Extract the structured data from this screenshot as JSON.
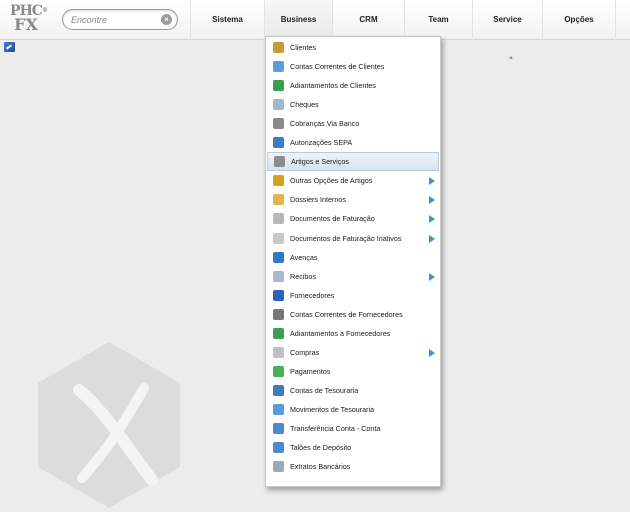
{
  "logo": {
    "line1": "PHC",
    "line2": "FX",
    "mark": "®"
  },
  "search": {
    "placeholder": "Encontre",
    "value": "",
    "clear_symbol": "×"
  },
  "nav": [
    {
      "label": "Sistema"
    },
    {
      "label": "Business"
    },
    {
      "label": "CRM"
    },
    {
      "label": "Team"
    },
    {
      "label": "Service"
    },
    {
      "label": "Opções"
    }
  ],
  "menu": {
    "items": [
      {
        "label": "Clientes",
        "icon": "user-icon",
        "color": "#c99a3a",
        "submenu": false
      },
      {
        "label": "Contas Correntes de Clientes",
        "icon": "folder-icon",
        "color": "#5aa0d8",
        "submenu": false
      },
      {
        "label": "Adiantamentos de Clientes",
        "icon": "money-green-icon",
        "color": "#3aa050",
        "submenu": false
      },
      {
        "label": "Cheques",
        "icon": "cheque-icon",
        "color": "#9bbad4",
        "submenu": false
      },
      {
        "label": "Cobranças Via Banco",
        "icon": "bank-building-icon",
        "color": "#8a8a8a",
        "submenu": false
      },
      {
        "label": "Autorizações SEPA",
        "icon": "sepa-icon",
        "color": "#3b7fc4",
        "submenu": false
      },
      {
        "label": "Artigos e Serviços",
        "icon": "articles-box-icon",
        "color": "#8c8c8c",
        "submenu": false,
        "active": true
      },
      {
        "label": "Outras Opções de Artigos",
        "icon": "bottle-icon",
        "color": "#d9a11f",
        "submenu": true
      },
      {
        "label": "Dossiers Internos",
        "icon": "dossier-icon",
        "color": "#e0b64a",
        "submenu": true
      },
      {
        "label": "Documentos de Faturação",
        "icon": "invoice-doc-icon",
        "color": "#b8b8b8",
        "submenu": true
      },
      {
        "label": "Documentos de Faturação Inativos",
        "icon": "inactive-doc-icon",
        "color": "#c8c8c8",
        "submenu": true
      },
      {
        "label": "Avenças",
        "icon": "contract-arrow-icon",
        "color": "#2f78c8",
        "submenu": false
      },
      {
        "label": "Recibos",
        "icon": "receipt-icon",
        "color": "#a8b8c8",
        "submenu": true
      },
      {
        "label": "Fornecedores",
        "icon": "supplier-user-icon",
        "color": "#2a64b4",
        "submenu": false
      },
      {
        "label": "Contas Correntes de Fornecedores",
        "icon": "supplier-folder-icon",
        "color": "#777777",
        "submenu": false
      },
      {
        "label": "Adiantamentos a Fornecedores",
        "icon": "supplier-money-icon",
        "color": "#3aa050",
        "submenu": false
      },
      {
        "label": "Compras",
        "icon": "purchases-doc-icon",
        "color": "#c0c0c0",
        "submenu": true
      },
      {
        "label": "Pagamentos",
        "icon": "payment-money-icon",
        "color": "#4bb05a",
        "submenu": false
      },
      {
        "label": "Contas de Tesouraria",
        "icon": "treasury-bank-icon",
        "color": "#3a7cc0",
        "submenu": false
      },
      {
        "label": "Movimentos de Tesouraria",
        "icon": "treasury-card-icon",
        "color": "#5a9ad6",
        "submenu": false
      },
      {
        "label": "Transferência Conta - Conta",
        "icon": "transfer-card-icon",
        "color": "#4a8ad0",
        "submenu": false
      },
      {
        "label": "Talões de Depósito",
        "icon": "deposit-slip-icon",
        "color": "#4a8ad0",
        "submenu": false
      },
      {
        "label": "Extratos Bancários",
        "icon": "bank-statement-icon",
        "color": "#9aaabb",
        "submenu": false
      }
    ]
  }
}
